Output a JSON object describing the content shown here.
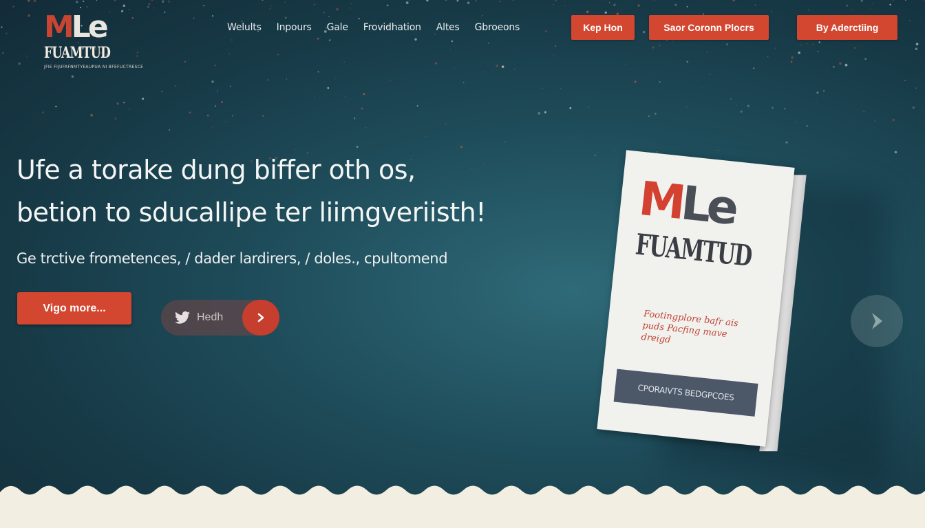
{
  "logo": {
    "mark_m": "M",
    "mark_le": "Le",
    "word": "FUAMTUD",
    "tag": "JFIE FIJUFAFNMTYEAUPUA NI BFEFUCTRESCE"
  },
  "nav": {
    "items": [
      "Welults",
      "Inpours",
      "Gale",
      "Frovidhation",
      "Altes",
      "Gbroeons"
    ],
    "buttons": [
      "Kep Hon",
      "Saor Coronn Plocrs",
      "By Aderctiing"
    ]
  },
  "hero": {
    "headline": [
      "Ufe a torake dung biffer oth os,",
      "betion to sducallipe ter liimgveriisth!"
    ],
    "subtitle": "Ge trctive frometences, / dader lardirers, / doles., cpultomend",
    "cta": "Vigo more...",
    "twitter_label": "Hedh"
  },
  "book": {
    "mark_m": "M",
    "mark_le": "Le",
    "word": "FUAMTUD",
    "description": "Footingplore bafr ais puds Pacfing mave dreigd",
    "button": "CPORAIVTS BEDGPCOES"
  },
  "colors": {
    "accent": "#d34730",
    "bg": "#1f4d5b",
    "cream": "#f2eee2"
  },
  "icons": {
    "twitter": "twitter-bird-icon",
    "arrow": "chevron-right-icon",
    "next": "next-slide-icon"
  }
}
